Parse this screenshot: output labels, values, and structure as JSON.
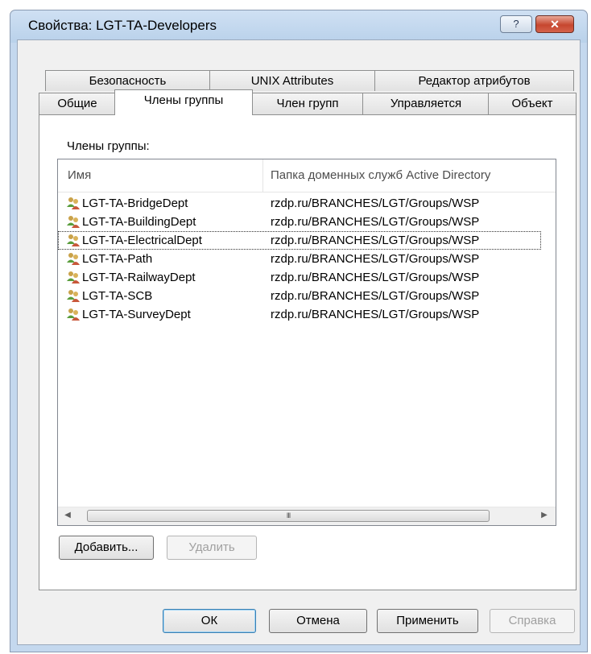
{
  "window": {
    "title": "Свойства: LGT-TA-Developers",
    "help_label": "?",
    "close_label": "✕"
  },
  "tabs": {
    "row_top": [
      "Безопасность",
      "UNIX Attributes",
      "Редактор атрибутов"
    ],
    "row_bottom": [
      "Общие",
      "Члены группы",
      "Член групп",
      "Управляется",
      "Объект"
    ],
    "active": "Члены группы"
  },
  "members": {
    "label": "Члены группы:",
    "columns": [
      "Имя",
      "Папка доменных служб Active Directory"
    ],
    "rows": [
      {
        "name": "LGT-TA-BridgeDept",
        "folder": "rzdp.ru/BRANCHES/LGT/Groups/WSP"
      },
      {
        "name": "LGT-TA-BuildingDept",
        "folder": "rzdp.ru/BRANCHES/LGT/Groups/WSP"
      },
      {
        "name": "LGT-TA-ElectricalDept",
        "folder": "rzdp.ru/BRANCHES/LGT/Groups/WSP"
      },
      {
        "name": "LGT-TA-Path",
        "folder": "rzdp.ru/BRANCHES/LGT/Groups/WSP"
      },
      {
        "name": "LGT-TA-RailwayDept",
        "folder": "rzdp.ru/BRANCHES/LGT/Groups/WSP"
      },
      {
        "name": "LGT-TA-SCB",
        "folder": "rzdp.ru/BRANCHES/LGT/Groups/WSP"
      },
      {
        "name": "LGT-TA-SurveyDept",
        "folder": "rzdp.ru/BRANCHES/LGT/Groups/WSP"
      }
    ],
    "focused_row": "LGT-TA-ElectricalDept",
    "row_icon": "group-icon",
    "scroll_thumb_grip": "III",
    "scroll_left": "◀",
    "scroll_right": "▶"
  },
  "actions": {
    "add_label": "Добавить...",
    "remove_label": "Удалить"
  },
  "footer": {
    "ok": "ОК",
    "cancel": "Отмена",
    "apply": "Применить",
    "help": "Справка"
  },
  "colors": {
    "title_bar": "#b9d1ea",
    "close_button": "#c6472f",
    "panel": "#ffffff",
    "dialog": "#f0f0f0"
  }
}
